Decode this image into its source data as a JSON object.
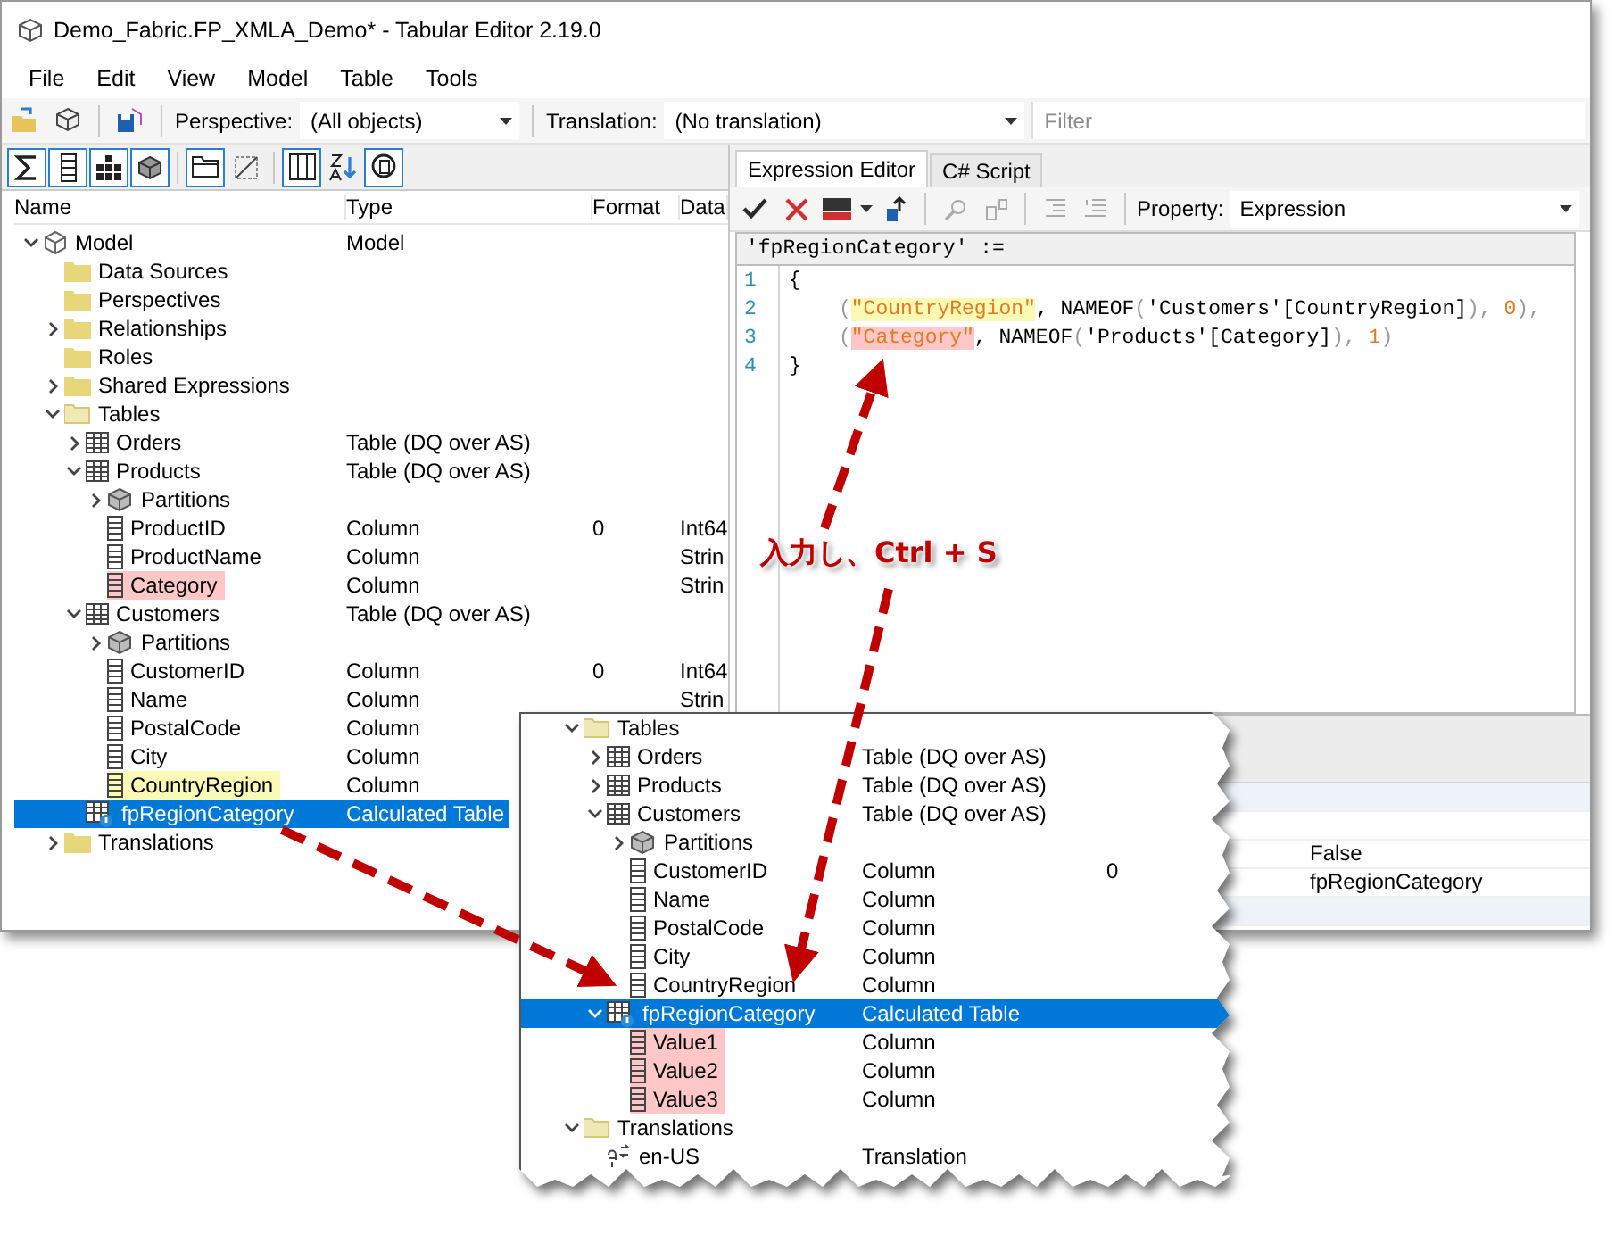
{
  "window": {
    "title": "Demo_Fabric.FP_XMLA_Demo* - Tabular Editor 2.19.0"
  },
  "menu": [
    "File",
    "Edit",
    "View",
    "Model",
    "Table",
    "Tools"
  ],
  "toolbar": {
    "perspective_label": "Perspective:",
    "perspective": "(All objects)",
    "translation_label": "Translation:",
    "translation": "(No translation)",
    "filter": {
      "placeholder": "Filter"
    }
  },
  "explorer": {
    "view_buttons": [
      {
        "on": true
      },
      {
        "on": true
      },
      {
        "on": true
      },
      {
        "on": true
      },
      {
        "on": true
      },
      {
        "on": false
      },
      {
        "on": true
      },
      {
        "on": false
      },
      {
        "on": true
      }
    ],
    "columns": [
      "Name",
      "Type",
      "Format",
      "Data"
    ],
    "tree": [
      {
        "name": "Model",
        "type": "Model",
        "kind": "model",
        "expanded": true,
        "selected": false,
        "children": [
          {
            "name": "Data Sources",
            "kind": "folder",
            "selected": false
          },
          {
            "name": "Perspectives",
            "kind": "folder",
            "selected": false
          },
          {
            "name": "Relationships",
            "kind": "folder",
            "expanded": false,
            "selected": false
          },
          {
            "name": "Roles",
            "kind": "folder",
            "selected": false
          },
          {
            "name": "Shared Expressions",
            "kind": "folder",
            "expanded": false,
            "selected": false
          },
          {
            "name": "Tables",
            "kind": "folder",
            "expanded": true,
            "selected": false,
            "children": [
              {
                "name": "Orders",
                "type": "Table (DQ over AS)",
                "kind": "table",
                "expanded": false,
                "selected": false
              },
              {
                "name": "Products",
                "type": "Table (DQ over AS)",
                "kind": "table",
                "expanded": true,
                "selected": false,
                "children": [
                  {
                    "name": "Partitions",
                    "kind": "partitions",
                    "expanded": false,
                    "selected": false
                  },
                  {
                    "name": "ProductID",
                    "type": "Column",
                    "format": "0",
                    "data": "Int64",
                    "kind": "column",
                    "selected": false
                  },
                  {
                    "name": "ProductName",
                    "type": "Column",
                    "data": "Strin",
                    "kind": "column",
                    "selected": false
                  },
                  {
                    "name": "Category",
                    "type": "Column",
                    "data": "Strin",
                    "kind": "column",
                    "selected": false,
                    "color": "#ffc7c7"
                  }
                ]
              },
              {
                "name": "Customers",
                "type": "Table (DQ over AS)",
                "kind": "table",
                "expanded": true,
                "selected": false,
                "children": [
                  {
                    "name": "Partitions",
                    "kind": "partitions",
                    "expanded": false,
                    "selected": false
                  },
                  {
                    "name": "CustomerID",
                    "type": "Column",
                    "format": "0",
                    "data": "Int64",
                    "kind": "column",
                    "selected": false
                  },
                  {
                    "name": "Name",
                    "type": "Column",
                    "data": "Strin",
                    "kind": "column",
                    "selected": false
                  },
                  {
                    "name": "PostalCode",
                    "type": "Column",
                    "kind": "column",
                    "selected": false
                  },
                  {
                    "name": "City",
                    "type": "Column",
                    "kind": "column",
                    "selected": false
                  },
                  {
                    "name": "CountryRegion",
                    "type": "Column",
                    "kind": "column",
                    "selected": false,
                    "color": "#fafab4"
                  }
                ]
              },
              {
                "name": "fpRegionCategory",
                "type": "Calculated Table",
                "kind": "calc-table",
                "selected": true
              }
            ]
          },
          {
            "name": "Translations",
            "kind": "folder",
            "expanded": false,
            "selected": false
          }
        ]
      }
    ]
  },
  "editor": {
    "tabs": [
      {
        "label": "Expression Editor",
        "selected": true
      },
      {
        "label": "C# Script",
        "selected": false
      }
    ],
    "property_label": "Property:",
    "property": "Expression",
    "header": "'fpRegionCategory' :=",
    "lines": [
      {
        "number": "1",
        "kind": "outer",
        "tokens": [
          {
            "text": "{",
            "kind": "plain"
          }
        ]
      },
      {
        "number": "2",
        "kind": "inner",
        "tokens": [
          {
            "text": "(",
            "kind": "bracket"
          },
          {
            "text": "\"CountryRegion\"",
            "kind": "string",
            "color": "#fafab4"
          },
          {
            "text": ", NAMEOF",
            "kind": "plain"
          },
          {
            "text": "(",
            "kind": "bracket"
          },
          {
            "text": "'Customers'[CountryRegion]",
            "kind": "plain"
          },
          {
            "text": "),",
            "kind": "bracket"
          },
          {
            "text": " 0",
            "kind": "number"
          },
          {
            "text": "),",
            "kind": "bracket"
          }
        ]
      },
      {
        "number": "3",
        "kind": "inner",
        "tokens": [
          {
            "text": "(",
            "kind": "bracket"
          },
          {
            "text": "\"Category\"",
            "kind": "string",
            "color": "#ffc7c7"
          },
          {
            "text": ", NAMEOF",
            "kind": "plain"
          },
          {
            "text": "(",
            "kind": "bracket"
          },
          {
            "text": "'Products'[Category]",
            "kind": "plain"
          },
          {
            "text": "),",
            "kind": "bracket"
          },
          {
            "text": " 1",
            "kind": "number"
          },
          {
            "text": ")",
            "kind": "bracket"
          }
        ]
      },
      {
        "number": "4",
        "kind": "outer",
        "tokens": [
          {
            "text": "}",
            "kind": "plain"
          }
        ]
      }
    ]
  },
  "properties": {
    "rows": [
      {
        "value": "False"
      },
      {
        "value": "fpRegionCategory"
      }
    ]
  },
  "zoom_panel": {
    "tree": [
      {
        "name": "Tables",
        "kind": "folder",
        "expanded": true,
        "selected": false,
        "children": [
          {
            "name": "Orders",
            "type": "Table (DQ over AS)",
            "kind": "table",
            "expanded": false,
            "selected": false
          },
          {
            "name": "Products",
            "type": "Table (DQ over AS)",
            "kind": "table",
            "expanded": false,
            "selected": false
          },
          {
            "name": "Customers",
            "type": "Table (DQ over AS)",
            "kind": "table",
            "expanded": true,
            "selected": false,
            "children": [
              {
                "name": "Partitions",
                "kind": "partitions",
                "expanded": false,
                "selected": false
              },
              {
                "name": "CustomerID",
                "type": "Column",
                "format": "0",
                "kind": "column",
                "selected": false
              },
              {
                "name": "Name",
                "type": "Column",
                "kind": "column",
                "selected": false
              },
              {
                "name": "PostalCode",
                "type": "Column",
                "kind": "column",
                "selected": false
              },
              {
                "name": "City",
                "type": "Column",
                "kind": "column",
                "selected": false
              },
              {
                "name": "CountryRegion",
                "type": "Column",
                "kind": "column",
                "selected": false
              }
            ]
          },
          {
            "name": "fpRegionCategory",
            "type": "Calculated Table",
            "kind": "calc-table",
            "expanded": true,
            "selected": true,
            "children": [
              {
                "name": "Value1",
                "type": "Column",
                "kind": "column",
                "selected": false,
                "color": "#ffc7c7"
              },
              {
                "name": "Value2",
                "type": "Column",
                "kind": "column",
                "selected": false,
                "color": "#ffc7c7"
              },
              {
                "name": "Value3",
                "type": "Column",
                "kind": "column",
                "selected": false,
                "color": "#ffc7c7"
              }
            ]
          }
        ]
      },
      {
        "name": "Translations",
        "kind": "folder",
        "expanded": true,
        "selected": false,
        "children": [
          {
            "name": "en-US",
            "type": "Translation",
            "kind": "translation",
            "selected": false
          }
        ]
      }
    ]
  },
  "annotation": {
    "text": "入力し、Ctrl + S"
  }
}
